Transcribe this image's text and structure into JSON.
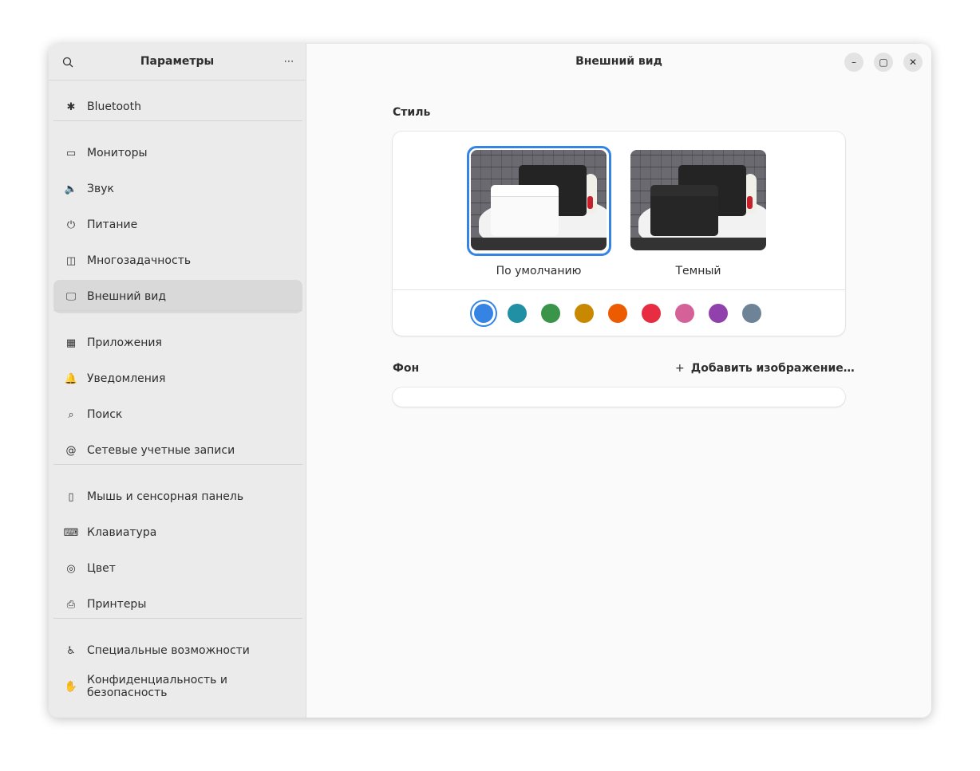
{
  "sidebar": {
    "title": "Параметры",
    "groups": [
      [
        "Bluetooth"
      ],
      [
        "Мониторы",
        "Звук",
        "Питание",
        "Многозадачность",
        "Внешний вид"
      ],
      [
        "Приложения",
        "Уведомления",
        "Поиск",
        "Сетевые учетные записи"
      ],
      [
        "Мышь и сенсорная панель",
        "Клавиатура",
        "Цвет",
        "Принтеры"
      ],
      [
        "Специальные возможности",
        "Конфиденциальность и безопасность"
      ]
    ],
    "selected": "Внешний вид"
  },
  "header": {
    "title": "Внешний вид"
  },
  "style": {
    "label": "Стиль",
    "options": [
      "По умолчанию",
      "Темный"
    ],
    "selected": "По умолчанию",
    "accents": [
      "#3584e4",
      "#2190a4",
      "#3a944a",
      "#c88800",
      "#ed5b00",
      "#e62d42",
      "#d56199",
      "#9141ac",
      "#6f8396"
    ],
    "accent_selected": "#3584e4"
  },
  "background": {
    "label": "Фон",
    "add_label": "Добавить изображение…"
  }
}
